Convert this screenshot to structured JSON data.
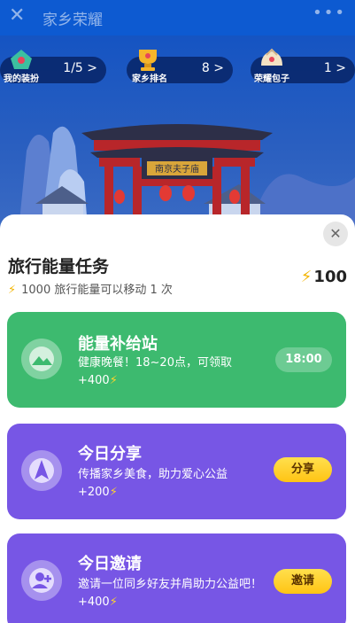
{
  "topbar": {
    "title": "家乡荣耀",
    "close_icon": "close-icon",
    "more_icon": "more-icon"
  },
  "stats": [
    {
      "label": "我的装扮",
      "value": "1/5 >",
      "icon": "costume-icon"
    },
    {
      "label": "家乡排名",
      "value": "8 >",
      "icon": "trophy-icon"
    },
    {
      "label": "荣耀包子",
      "value": "1 >",
      "icon": "bun-icon"
    }
  ],
  "hero": {
    "gate_plaque": "南京夫子庙"
  },
  "sheet": {
    "title": "旅行能量任务",
    "subtitle": "1000 旅行能量可以移动 1 次",
    "energy_total": "100",
    "tasks": [
      {
        "name": "能量补给站",
        "desc": "健康晚餐！18~20点，可领取",
        "reward": "+400",
        "button": "18:00",
        "color": "#3dba6f"
      },
      {
        "name": "今日分享",
        "desc": "传播家乡美食，助力爱心公益",
        "reward": "+200",
        "button": "分享",
        "color": "#7756e5"
      },
      {
        "name": "今日邀请",
        "desc": "邀请一位同乡好友并肩助力公益吧！",
        "reward": "+400",
        "button": "邀请",
        "color": "#7756e5"
      }
    ]
  },
  "colors": {
    "accent_yellow": "#ffc414",
    "green_card": "#3dba6f",
    "purple_card": "#7756e5",
    "hero_blue": "#1554c2"
  }
}
